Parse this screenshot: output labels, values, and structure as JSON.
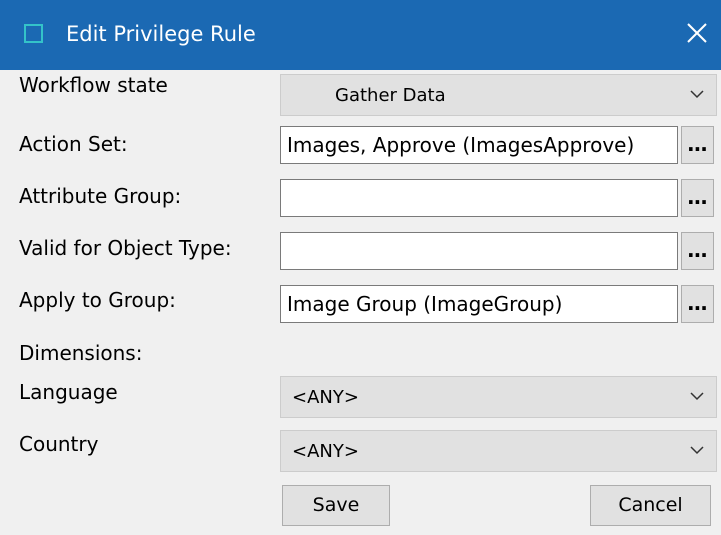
{
  "window": {
    "title": "Edit Privilege Rule"
  },
  "form": {
    "workflow_state": {
      "label": "Workflow state",
      "value": "Gather Data"
    },
    "action_set": {
      "label": "Action Set:",
      "value": "Images, Approve (ImagesApprove)"
    },
    "attribute_group": {
      "label": "Attribute Group:",
      "value": ""
    },
    "valid_for_object_type": {
      "label": "Valid for Object Type:",
      "value": ""
    },
    "apply_to_group": {
      "label": "Apply to Group:",
      "value": "Image Group (ImageGroup)"
    },
    "dimensions_label": "Dimensions:",
    "language": {
      "label": "Language",
      "value": "<ANY>"
    },
    "country": {
      "label": "Country",
      "value": "<ANY>"
    },
    "browse_label": "..."
  },
  "buttons": {
    "save": "Save",
    "cancel": "Cancel"
  },
  "icons": {
    "app": "window-icon",
    "close": "close-icon",
    "dropdown": "chevron-down-icon"
  },
  "colors": {
    "titlebar": "#1b69b3",
    "dialog_bg": "#f0f0f0",
    "control_bg": "#e1e1e1"
  }
}
